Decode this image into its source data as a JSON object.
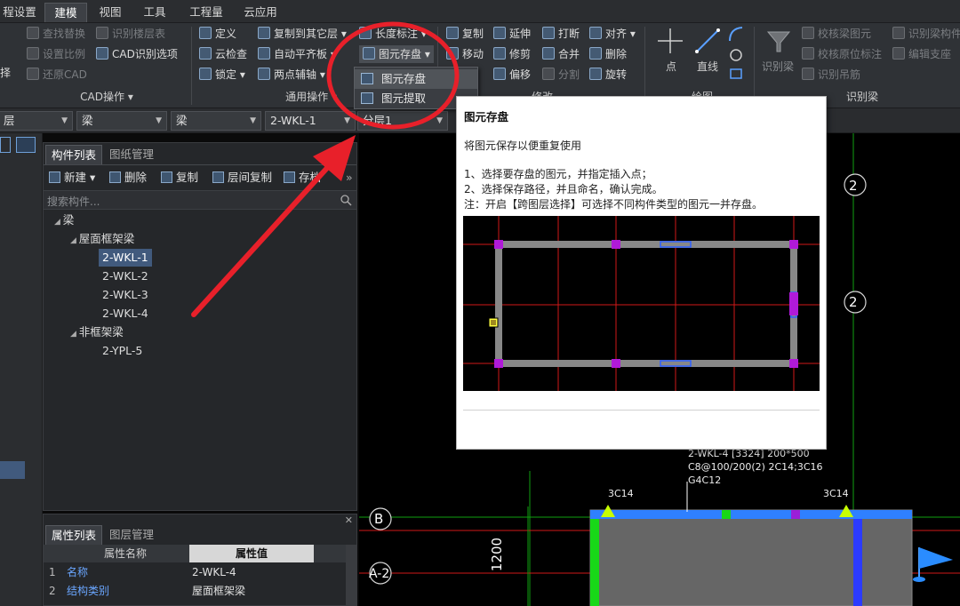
{
  "menu": {
    "items": [
      "程设置",
      "建模",
      "视图",
      "工具",
      "工程量",
      "云应用"
    ],
    "active": "建模"
  },
  "ribbon": {
    "cad_group": {
      "label": "CAD操作",
      "items": [
        "查找替换",
        "识别楼层表",
        "设置比例",
        "CAD识别选项",
        "还原CAD"
      ],
      "left_clip": "择"
    },
    "general_group": {
      "label": "通用操作",
      "items": [
        "定义",
        "复制到其它层",
        "长度标注",
        "云检查",
        "自动平齐板",
        "图元存盘",
        "锁定",
        "两点辅轴"
      ]
    },
    "modify_group": {
      "label": "修改",
      "items": [
        "复制",
        "延伸",
        "打断",
        "对齐",
        "移动",
        "修剪",
        "合并",
        "删除",
        "偏移",
        "分割",
        "旋转"
      ]
    },
    "draw_group": {
      "label": "绘图",
      "items": [
        "点",
        "直线"
      ]
    },
    "recog_group": {
      "label": "识别梁",
      "items": [
        "识别梁",
        "校核梁图元",
        "识别梁构件",
        "校核原位标注",
        "编辑支座",
        "识别吊筋"
      ]
    }
  },
  "selectors": {
    "floor": "层",
    "type1": "梁",
    "type2": "梁",
    "component": "2-WKL-1",
    "layer": "分层1"
  },
  "dropdown": {
    "items": [
      "图元存盘",
      "图元提取"
    ]
  },
  "tooltip": {
    "title": "图元存盘",
    "desc": "将图元保存以便重复使用",
    "step1": "1、选择要存盘的图元，并指定插入点；",
    "step2": "2、选择保存路径，并且命名，确认完成。",
    "note": "注：开启【跨图层选择】可选择不同构件类型的图元一并存盘。"
  },
  "panel": {
    "tabs": [
      "构件列表",
      "图纸管理"
    ],
    "toolbar": [
      "新建",
      "删除",
      "复制",
      "层间复制",
      "存档"
    ],
    "search_placeholder": "搜索构件...",
    "tree": {
      "root": "梁",
      "group1": "屋面框架梁",
      "group1_items": [
        "2-WKL-1",
        "2-WKL-2",
        "2-WKL-3",
        "2-WKL-4"
      ],
      "group2": "非框架梁",
      "group2_items": [
        "2-YPL-5"
      ]
    }
  },
  "props": {
    "tabs": [
      "属性列表",
      "图层管理"
    ],
    "headers": [
      "属性名称",
      "属性值"
    ],
    "rows": [
      {
        "no": "1",
        "name": "名称",
        "value": "2-WKL-4"
      },
      {
        "no": "2",
        "name": "结构类别",
        "value": "屋面框架梁"
      }
    ]
  },
  "canvas": {
    "axis_labels": [
      "2",
      "2",
      "B",
      "A-2"
    ],
    "dimension": "1200",
    "beam_annot": [
      "2-WKL-4 [3324] 200*500",
      "C8@100/200(2) 2C14;3C16",
      "G4C12"
    ],
    "rebar_left": "3C14",
    "rebar_right": "3C14"
  },
  "colors": {
    "highlight_circle": "#e8202a",
    "grid_red": "#d01818",
    "grid_green": "#0fa00f",
    "beam_blue": "#2f80ff",
    "selection": "#415a7d"
  }
}
